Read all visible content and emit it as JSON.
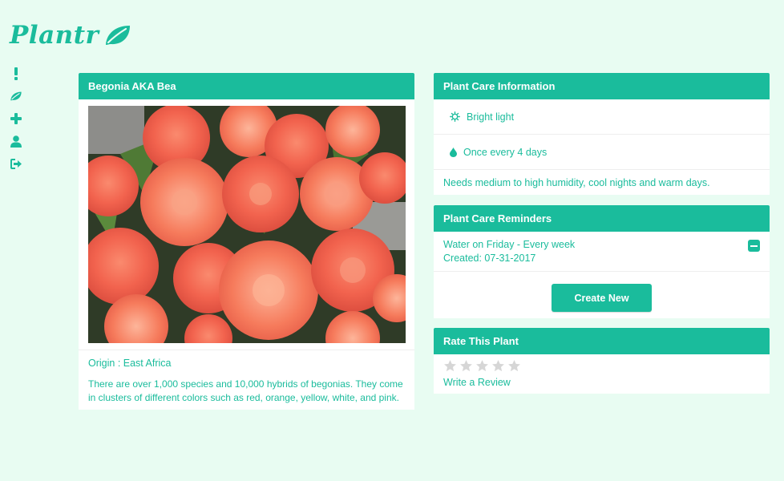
{
  "app": {
    "logo_text": "Plantr",
    "logo_icon": "leaf-icon",
    "accent_color": "#1abc9c",
    "background_color": "#e8fcf2"
  },
  "sidebar": {
    "items": [
      {
        "name": "alerts",
        "icon": "exclamation-icon"
      },
      {
        "name": "plants",
        "icon": "leaf-icon"
      },
      {
        "name": "add-plant",
        "icon": "plus-icon"
      },
      {
        "name": "profile",
        "icon": "user-icon"
      },
      {
        "name": "logout",
        "icon": "sign-out-icon"
      }
    ]
  },
  "plant": {
    "title": "Begonia AKA Bea",
    "photo_subject": "orange-red begonia flowers",
    "origin": "Origin : East Africa",
    "description": "There are over 1,000 species and 10,000 hybrids of begonias. They come in clusters of different colors such as red, orange, yellow, white, and pink."
  },
  "care": {
    "title": "Plant Care Information",
    "light_icon": "sun-icon",
    "light": "Bright light",
    "water_icon": "water-drop-icon",
    "water": "Once every 4 days",
    "note": "Needs medium to high humidity, cool nights and warm days."
  },
  "reminders": {
    "title": "Plant Care Reminders",
    "items": [
      {
        "text": "Water on Friday - Every week",
        "created": "Created: 07-31-2017"
      }
    ],
    "create_label": "Create New"
  },
  "rating": {
    "title": "Rate This Plant",
    "value": 0,
    "max": 5,
    "review_label": "Write a Review"
  }
}
